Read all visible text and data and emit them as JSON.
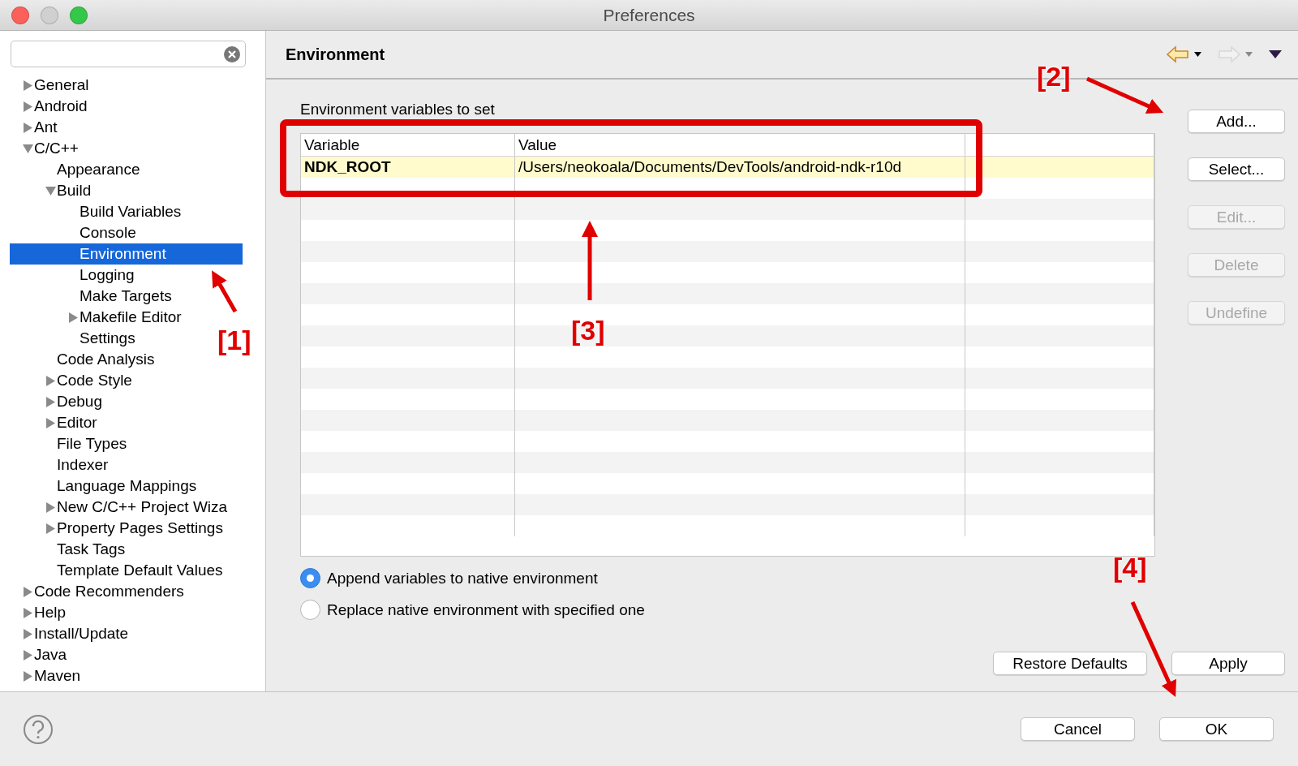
{
  "window": {
    "title": "Preferences"
  },
  "sidebar": {
    "tree": [
      {
        "label": "General",
        "kind": "branch",
        "expanded": false,
        "selected": false
      },
      {
        "label": "Android",
        "kind": "branch",
        "expanded": false,
        "selected": false
      },
      {
        "label": "Ant",
        "kind": "branch",
        "expanded": false,
        "selected": false
      },
      {
        "label": "C/C++",
        "kind": "branch",
        "expanded": true,
        "selected": false,
        "children": [
          {
            "label": "Appearance",
            "kind": "leaf",
            "selected": false
          },
          {
            "label": "Build",
            "kind": "branch",
            "expanded": true,
            "selected": false,
            "children": [
              {
                "label": "Build Variables",
                "kind": "leaf",
                "selected": false
              },
              {
                "label": "Console",
                "kind": "leaf",
                "selected": false
              },
              {
                "label": "Environment",
                "kind": "leaf",
                "selected": true
              },
              {
                "label": "Logging",
                "kind": "leaf",
                "selected": false
              },
              {
                "label": "Make Targets",
                "kind": "leaf",
                "selected": false
              },
              {
                "label": "Makefile Editor",
                "kind": "branch",
                "expanded": false,
                "selected": false
              },
              {
                "label": "Settings",
                "kind": "leaf",
                "selected": false
              }
            ]
          },
          {
            "label": "Code Analysis",
            "kind": "leaf",
            "selected": false
          },
          {
            "label": "Code Style",
            "kind": "branch",
            "expanded": false,
            "selected": false
          },
          {
            "label": "Debug",
            "kind": "branch",
            "expanded": false,
            "selected": false
          },
          {
            "label": "Editor",
            "kind": "branch",
            "expanded": false,
            "selected": false
          },
          {
            "label": "File Types",
            "kind": "leaf",
            "selected": false
          },
          {
            "label": "Indexer",
            "kind": "leaf",
            "selected": false
          },
          {
            "label": "Language Mappings",
            "kind": "leaf",
            "selected": false
          },
          {
            "label": "New C/C++ Project Wiza",
            "kind": "branch",
            "expanded": false,
            "selected": false
          },
          {
            "label": "Property Pages Settings",
            "kind": "branch",
            "expanded": false,
            "selected": false
          },
          {
            "label": "Task Tags",
            "kind": "leaf",
            "selected": false
          },
          {
            "label": "Template Default Values",
            "kind": "leaf",
            "selected": false
          }
        ]
      },
      {
        "label": "Code Recommenders",
        "kind": "branch",
        "expanded": false,
        "selected": false
      },
      {
        "label": "Help",
        "kind": "branch",
        "expanded": false,
        "selected": false
      },
      {
        "label": "Install/Update",
        "kind": "branch",
        "expanded": false,
        "selected": false
      },
      {
        "label": "Java",
        "kind": "branch",
        "expanded": false,
        "selected": false
      },
      {
        "label": "Maven",
        "kind": "branch",
        "expanded": false,
        "selected": false
      }
    ]
  },
  "page": {
    "title": "Environment",
    "caption": "Environment variables to set",
    "table": {
      "columns": [
        "Variable",
        "Value"
      ],
      "rows": [
        {
          "variable": "NDK_ROOT",
          "value": "/Users/neokoala/Documents/DevTools/android-ndk-r10d"
        }
      ]
    },
    "side_buttons": [
      {
        "label": "Add...",
        "disabled": false
      },
      {
        "label": "Select...",
        "disabled": false
      },
      {
        "label": "Edit...",
        "disabled": true
      },
      {
        "label": "Delete",
        "disabled": true
      },
      {
        "label": "Undefine",
        "disabled": true
      }
    ],
    "options": [
      {
        "label": "Append variables to native environment",
        "selected": true
      },
      {
        "label": "Replace native environment with specified one",
        "selected": false
      }
    ],
    "buttons": [
      "Restore Defaults",
      "Apply"
    ]
  },
  "footer": {
    "buttons": [
      "Cancel",
      "OK"
    ]
  },
  "annotations": [
    "[1]",
    "[2]",
    "[3]",
    "[4]"
  ]
}
